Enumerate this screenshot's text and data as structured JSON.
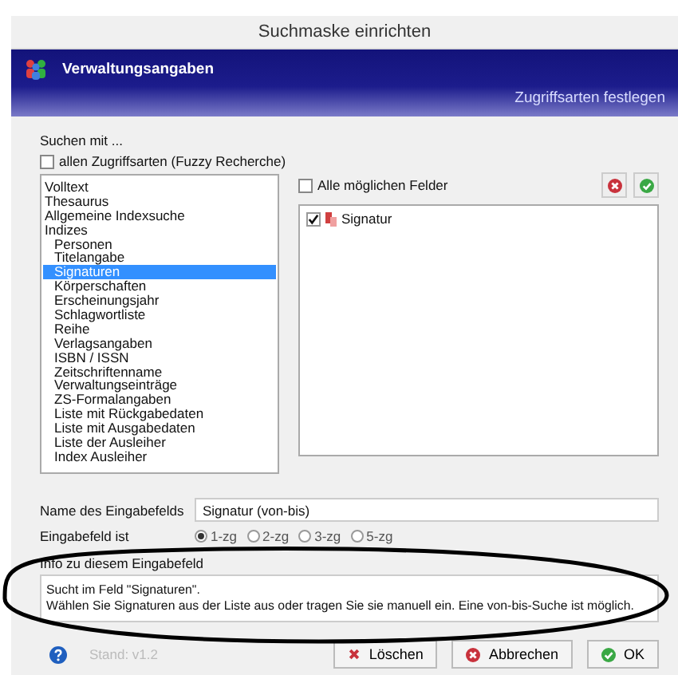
{
  "window": {
    "title": "Suchmaske einrichten"
  },
  "header": {
    "title": "Verwaltungsangaben",
    "subtitle": "Zugriffsarten festlegen"
  },
  "search_with": {
    "label": "Suchen mit ...",
    "fuzzy": {
      "label": "allen Zugriffsarten (Fuzzy Recherche)",
      "checked": false
    }
  },
  "access_list": {
    "items": [
      {
        "label": "Volltext",
        "selected": false
      },
      {
        "label": "Thesaurus",
        "selected": false
      },
      {
        "label": "Allgemeine Indexsuche",
        "selected": false
      },
      {
        "label": "Indizes",
        "selected": false,
        "children": [
          {
            "label": "Personen",
            "selected": false
          },
          {
            "label": "Titelangabe",
            "selected": false
          },
          {
            "label": "Signaturen",
            "selected": true
          },
          {
            "label": "Körperschaften",
            "selected": false
          },
          {
            "label": "Erscheinungsjahr",
            "selected": false
          },
          {
            "label": "Schlagwortliste",
            "selected": false
          },
          {
            "label": "Reihe",
            "selected": false
          },
          {
            "label": "Verlagsangaben",
            "selected": false
          },
          {
            "label": "ISBN / ISSN",
            "selected": false
          },
          {
            "label": "Zeitschriftenname",
            "selected": false
          },
          {
            "label": "Verwaltungseinträge",
            "selected": false
          },
          {
            "label": "ZS-Formalangaben",
            "selected": false
          },
          {
            "label": "Liste mit Rückgabedaten",
            "selected": false
          },
          {
            "label": "Liste mit Ausgabedaten",
            "selected": false
          },
          {
            "label": "Liste der Ausleiher",
            "selected": false
          },
          {
            "label": "Index Ausleiher",
            "selected": false
          }
        ]
      }
    ]
  },
  "fields": {
    "all_checkbox": {
      "label": "Alle möglichen Felder",
      "checked": false
    },
    "items": [
      {
        "label": "Signatur",
        "checked": true
      }
    ]
  },
  "name_field": {
    "label": "Name des Eingabefelds",
    "value": "Signatur (von-bis)"
  },
  "field_type": {
    "label": "Eingabefeld ist",
    "options": [
      {
        "label": "1-zg",
        "selected": true
      },
      {
        "label": "2-zg",
        "selected": false
      },
      {
        "label": "3-zg",
        "selected": false
      },
      {
        "label": "5-zg",
        "selected": false
      }
    ]
  },
  "info": {
    "label": "Info zu diesem Eingabefeld",
    "lines": [
      "Sucht im Feld \"Signaturen\".",
      "Wählen Sie Signaturen aus der Liste aus oder tragen Sie sie manuell ein. Eine von-bis-Suche ist möglich."
    ]
  },
  "footer": {
    "version": "Stand: v1.2",
    "buttons": [
      {
        "label": "Löschen",
        "kind": "delete"
      },
      {
        "label": "Abbrechen",
        "kind": "cancel"
      },
      {
        "label": "OK",
        "kind": "ok"
      }
    ]
  }
}
